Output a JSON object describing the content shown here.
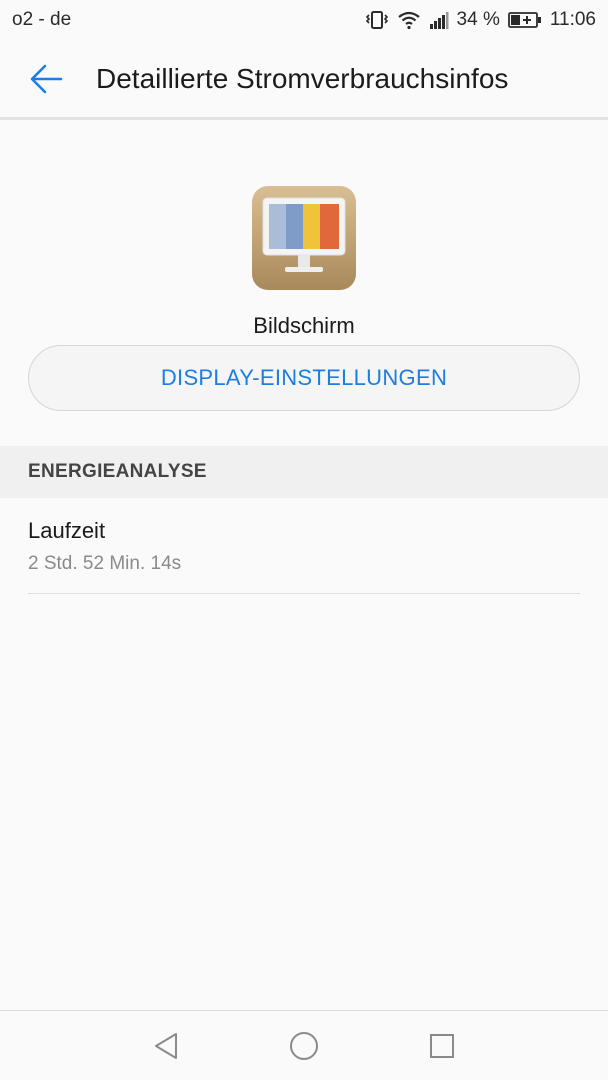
{
  "status_bar": {
    "carrier": "o2 - de",
    "battery_percent": "34 %",
    "time": "11:06",
    "icons": [
      "vibrate-icon",
      "wifi-icon",
      "signal-icon",
      "battery-charging-icon"
    ]
  },
  "app_bar": {
    "title": "Detaillierte Stromverbrauchsinfos",
    "back_icon": "arrow-left-icon"
  },
  "summary": {
    "app_icon": "display-monitor-icon",
    "app_name": "Bildschirm",
    "settings_button_label": "DISPLAY-EINSTELLUNGEN"
  },
  "energy_section": {
    "header": "ENERGIEANALYSE",
    "items": [
      {
        "title": "Laufzeit",
        "value": "2 Std. 52 Min. 14s"
      }
    ]
  },
  "nav_bar": {
    "buttons": [
      "back-triangle-icon",
      "home-circle-icon",
      "recents-square-icon"
    ]
  },
  "colors": {
    "accent": "#1a7fe0",
    "background": "#fafafa",
    "section_header_bg": "#f0f0f0"
  }
}
